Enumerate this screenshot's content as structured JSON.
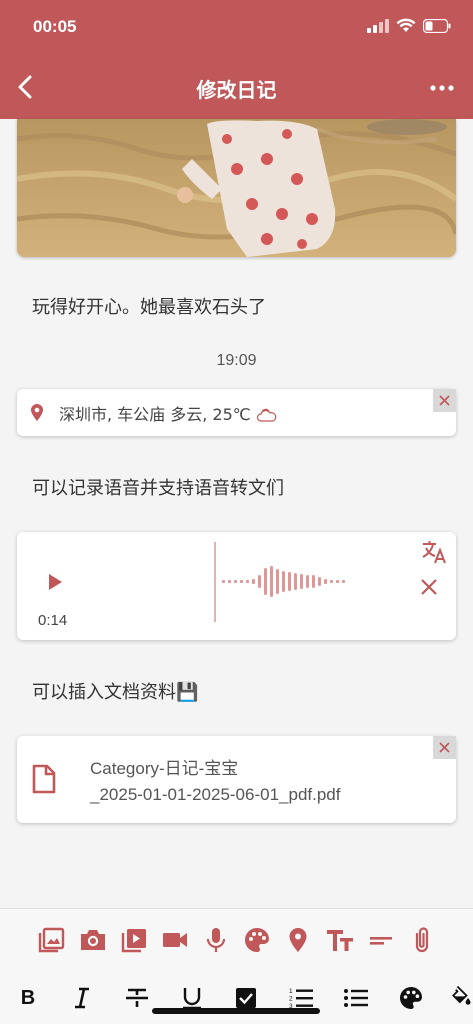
{
  "status_bar": {
    "time": "00:05"
  },
  "header": {
    "title": "修改日记",
    "back_icon": "chevron-left-icon",
    "more_icon": "more-horizontal-icon"
  },
  "entry": {
    "text": "玩得好开心。她最喜欢石头了",
    "time": "19:09",
    "location": "深圳市, 车公庙 多云, 25℃",
    "weather_icon": "cloudy-day-icon",
    "note_audio": "可以记录语音并支持语音转文们",
    "audio_duration": "0:14",
    "note_doc": "可以插入文档资料💾",
    "file_name_line1": "Category-日记-宝宝",
    "file_name_line2": "_2025-01-01-2025-06-01_pdf.pdf"
  },
  "colors": {
    "accent": "#c0585a",
    "background": "#f4f4f4",
    "card": "#ffffff"
  },
  "toolbar": {
    "insert_icons": [
      "image-icon",
      "camera-icon",
      "video-library-icon",
      "video-camera-icon",
      "microphone-icon",
      "palette-icon",
      "location-icon",
      "text-size-icon",
      "divider-icon",
      "attachment-icon"
    ],
    "format_icons": [
      "bold-icon",
      "italic-icon",
      "strikethrough-icon",
      "underline-icon",
      "checkbox-icon",
      "numbered-list-icon",
      "bullet-list-icon",
      "palette-icon",
      "fill-color-icon"
    ]
  }
}
